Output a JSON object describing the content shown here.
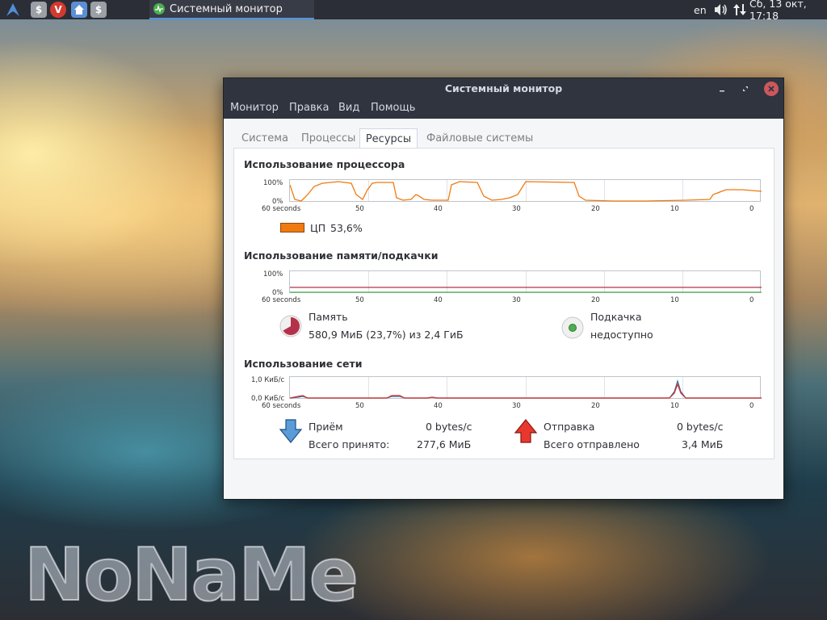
{
  "panel": {
    "launchers": [
      "$",
      "V",
      "$"
    ],
    "task_title": "Системный монитор",
    "lang": "en",
    "clock": "Сб, 13 окт, 17:18"
  },
  "window": {
    "title": "Системный монитор",
    "menu": [
      "Монитор",
      "Правка",
      "Вид",
      "Помощь"
    ],
    "tabs": [
      "Система",
      "Процессы",
      "Ресурсы",
      "Файловые системы"
    ],
    "active_tab": "Ресурсы"
  },
  "cpu": {
    "heading": "Использование процессора",
    "y_labels": [
      "100%",
      "0%"
    ],
    "x_labels": [
      "60 seconds",
      "50",
      "40",
      "30",
      "20",
      "10",
      "0"
    ],
    "legend_name": "ЦП",
    "legend_value": "53,6%",
    "color": "#f07a10"
  },
  "memory": {
    "heading": "Использование памяти/подкачки",
    "y_labels": [
      "100%",
      "0%"
    ],
    "x_labels": [
      "60 seconds",
      "50",
      "40",
      "30",
      "20",
      "10",
      "0"
    ],
    "mem_label": "Память",
    "mem_value": "580,9 МиБ (23,7%) из 2,4 ГиБ",
    "swap_label": "Подкачка",
    "swap_value": "недоступно",
    "mem_color": "#b5314a",
    "swap_color": "#4caf50"
  },
  "network": {
    "heading": "Использование сети",
    "y_labels": [
      "1,0 КиБ/с",
      "0,0 КиБ/с"
    ],
    "x_labels": [
      "60 seconds",
      "50",
      "40",
      "30",
      "20",
      "10",
      "0"
    ],
    "recv_label": "Приём",
    "recv_rate": "0 bytes/с",
    "recv_total_label": "Всего принято:",
    "recv_total": "277,6 МиБ",
    "send_label": "Отправка",
    "send_rate": "0 bytes/с",
    "send_total_label": "Всего отправлено",
    "send_total": "3,4 МиБ",
    "recv_color": "#2f6ea8",
    "send_color": "#d9302a"
  },
  "desktop": {
    "watermark": "NoNaMe"
  }
}
